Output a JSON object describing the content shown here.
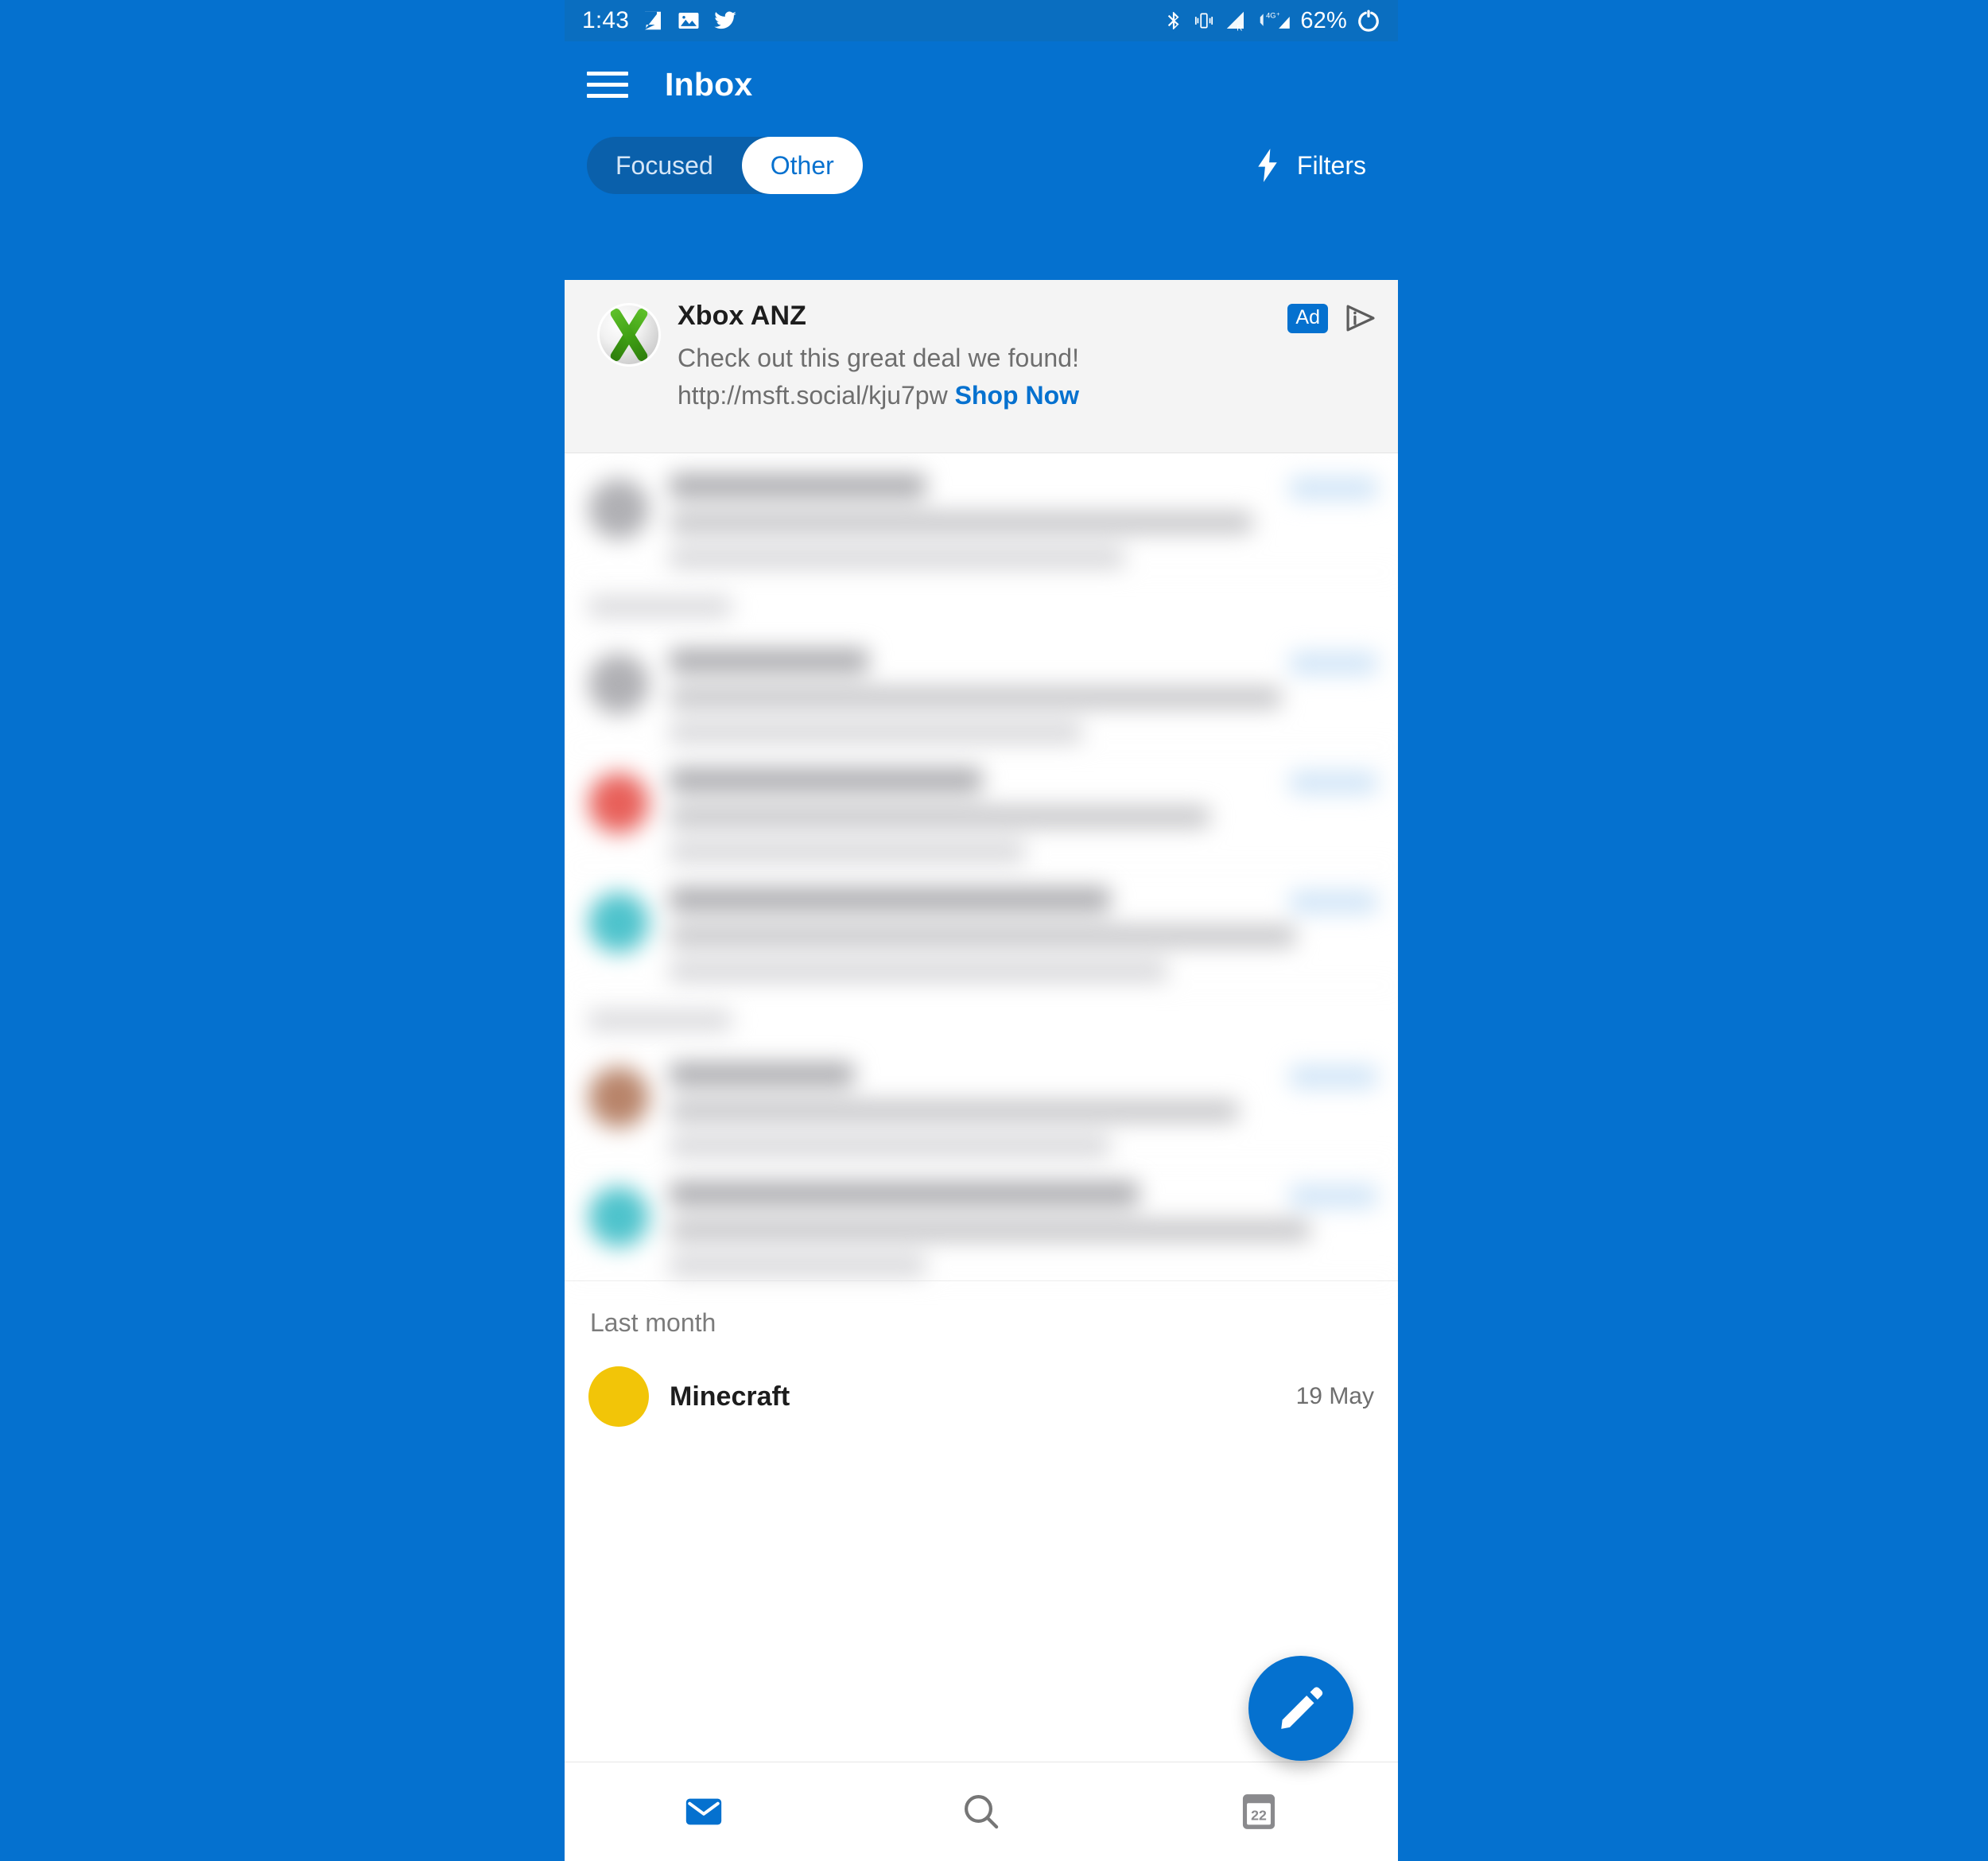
{
  "theme": {
    "brand_blue": "#0571cf",
    "statusbar_blue": "#0a6ec0",
    "pill_track_blue": "#0a60ab",
    "link_blue": "#0571cf",
    "ad_card_bg": "#f4f4f4"
  },
  "status_bar": {
    "time": "1:43",
    "battery": "62%",
    "left_icons": [
      "note-app-icon",
      "photos-icon",
      "twitter-icon"
    ],
    "right_icons": [
      "bluetooth-icon",
      "vibrate-icon",
      "signal-roaming-icon",
      "signal-4g-plus-icon",
      "battery-charging-icon"
    ]
  },
  "app_bar": {
    "menu_icon": "hamburger-menu-icon",
    "title": "Inbox",
    "tabs": [
      {
        "label": "Focused",
        "selected": false
      },
      {
        "label": "Other",
        "selected": true
      }
    ],
    "filters": {
      "label": "Filters",
      "icon": "lightning-bolt-icon"
    }
  },
  "ad_card": {
    "avatar_icon": "xbox-logo-icon",
    "sender": "Xbox ANZ",
    "badge": "Ad",
    "adchoices_icon": "adchoices-icon",
    "body": "Check out this great deal we found!",
    "url": "http://msft.social/kju7pw",
    "cta": "Shop Now"
  },
  "mail_list": {
    "note": "message rows are blurred for privacy",
    "rows": [
      {
        "avatar_color": "#b0b0b4",
        "blurred": true
      },
      {
        "section_header_blurred": true
      },
      {
        "avatar_color": "#b0b0b4",
        "blurred": true
      },
      {
        "avatar_color": "#e8605a",
        "blurred": true
      },
      {
        "avatar_color": "#4ec3cc",
        "blurred": true
      },
      {
        "section_header_blurred": true
      },
      {
        "avatar_color": "#b8846a",
        "blurred": true
      },
      {
        "avatar_color": "#4ec3cc",
        "blurred": true
      }
    ],
    "last_section": {
      "header": "Last month",
      "item": {
        "avatar_color": "#f2c508",
        "sender": "Minecraft",
        "date": "19 May"
      }
    }
  },
  "fab": {
    "icon": "compose-pencil-icon"
  },
  "bottom_nav": [
    {
      "icon": "mail-icon",
      "active": true
    },
    {
      "icon": "search-icon",
      "active": false
    },
    {
      "icon": "calendar-icon",
      "active": false,
      "day": "22"
    }
  ]
}
